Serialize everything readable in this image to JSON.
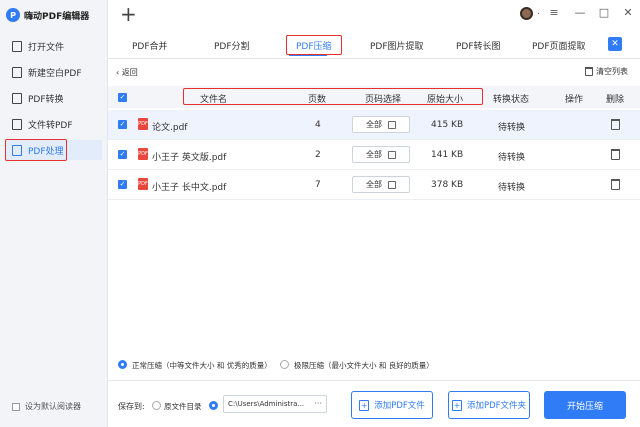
{
  "app": {
    "title": "嗨动PDF编辑器",
    "logo_char": "P"
  },
  "sidebar": {
    "items": [
      {
        "label": "打开文件"
      },
      {
        "label": "新建空白PDF"
      },
      {
        "label": "PDF转换"
      },
      {
        "label": "文件转PDF"
      },
      {
        "label": "PDF处理",
        "active": true
      }
    ],
    "default_reader": "设为默认阅读器"
  },
  "topbar": {
    "add": "+",
    "more": ".",
    "menu": "≡",
    "minimize": "—",
    "maximize": "□",
    "close": "✕"
  },
  "tabs": [
    "PDF合并",
    "PDF分割",
    "PDF压缩",
    "PDF图片提取",
    "PDF转长图",
    "PDF页面提取"
  ],
  "active_tab": "PDF压缩",
  "back_label": "返回",
  "clear_label": "清空列表",
  "table": {
    "columns": [
      "文件名",
      "页数",
      "页码选择",
      "原始大小",
      "转换状态",
      "操作",
      "删除"
    ],
    "rows": [
      {
        "name": "论文.pdf",
        "pages": "4",
        "range": "全部",
        "size": "415 KB",
        "status": "待转换",
        "selected": true
      },
      {
        "name": "小王子 英文版.pdf",
        "pages": "2",
        "range": "全部",
        "size": "141 KB",
        "status": "待转换"
      },
      {
        "name": "小王子 长中文.pdf",
        "pages": "7",
        "range": "全部",
        "size": "378 KB",
        "status": "待转换"
      }
    ]
  },
  "options": {
    "normal": "正常压缩（中等文件大小 和 优秀的质量）",
    "extreme": "极限压缩（最小文件大小 和 良好的质量）"
  },
  "footer": {
    "save_to": "保存到:",
    "orig_dir": "原文件目录",
    "path": "C:\\Users\\Administra...",
    "path_more": "···",
    "add_file": "添加PDF文件",
    "add_folder": "添加PDF文件夹",
    "start": "开始压缩"
  },
  "colors": {
    "accent": "#2f7cf6",
    "highlight": "#e53030"
  }
}
